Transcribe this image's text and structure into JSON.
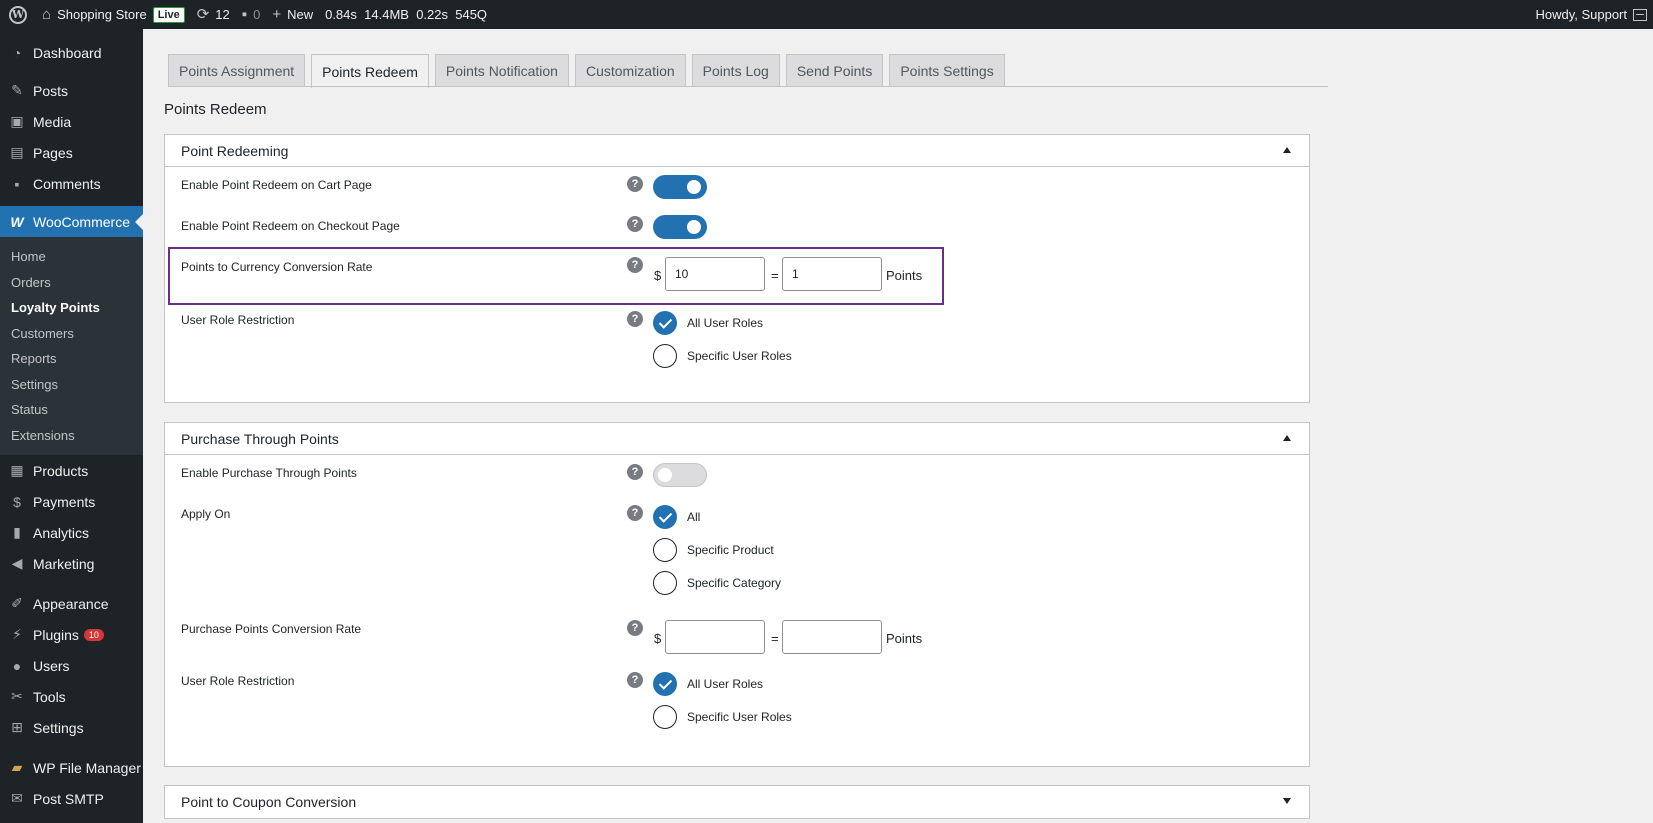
{
  "admin_bar": {
    "site_name": "Shopping Store",
    "live_label": "Live",
    "updates_count": "12",
    "comments_count": "0",
    "new_label": "New",
    "perf": [
      "0.84s",
      "14.4MB",
      "0.22s",
      "545Q"
    ],
    "greeting": "Howdy, Support"
  },
  "sidebar": {
    "top": [
      {
        "label": "Dashboard",
        "icon": "dashboard-icon"
      }
    ],
    "group1": [
      {
        "label": "Posts",
        "icon": "pin-icon"
      },
      {
        "label": "Media",
        "icon": "media-icon"
      },
      {
        "label": "Pages",
        "icon": "pages-icon"
      },
      {
        "label": "Comments",
        "icon": "comment-icon"
      }
    ],
    "woocommerce": {
      "label": "WooCommerce",
      "icon": "woo-icon"
    },
    "woo_sub": [
      "Home",
      "Orders",
      "Loyalty Points",
      "Customers",
      "Reports",
      "Settings",
      "Status",
      "Extensions"
    ],
    "group2": [
      {
        "label": "Products",
        "icon": "products-icon"
      },
      {
        "label": "Payments",
        "icon": "payments-icon"
      },
      {
        "label": "Analytics",
        "icon": "analytics-icon"
      },
      {
        "label": "Marketing",
        "icon": "megaphone-icon"
      }
    ],
    "group3": [
      {
        "label": "Appearance",
        "icon": "brush-icon"
      },
      {
        "label": "Plugins",
        "icon": "plugin-icon",
        "badge": "10"
      },
      {
        "label": "Users",
        "icon": "users-icon"
      },
      {
        "label": "Tools",
        "icon": "wrench-icon"
      },
      {
        "label": "Settings",
        "icon": "settings-icon"
      }
    ],
    "group4": [
      {
        "label": "WP File Manager",
        "icon": "folder-icon"
      },
      {
        "label": "Post SMTP",
        "icon": "mail-icon"
      }
    ]
  },
  "tabs": [
    "Points Assignment",
    "Points Redeem",
    "Points Notification",
    "Customization",
    "Points Log",
    "Send Points",
    "Points Settings"
  ],
  "active_tab": "Points Redeem",
  "page_title": "Points Redeem",
  "panel1": {
    "title": "Point Redeeming",
    "cart_label": "Enable Point Redeem on Cart Page",
    "cart_enabled": true,
    "checkout_label": "Enable Point Redeem on Checkout Page",
    "checkout_enabled": true,
    "rate_label": "Points to Currency Conversion Rate",
    "currency_symbol": "$",
    "currency_value": "10",
    "equals": "=",
    "points_value": "1",
    "points_unit": "Points",
    "role_label": "User Role Restriction",
    "role_options": [
      "All User Roles",
      "Specific User Roles"
    ],
    "role_selected": "All User Roles"
  },
  "panel2": {
    "title": "Purchase Through Points",
    "enable_label": "Enable Purchase Through Points",
    "enable_on": false,
    "apply_label": "Apply On",
    "apply_options": [
      "All",
      "Specific Product",
      "Specific Category"
    ],
    "apply_selected": "All",
    "rate_label": "Purchase Points Conversion Rate",
    "currency_symbol": "$",
    "currency_value": "",
    "equals": "=",
    "points_value": "",
    "points_unit": "Points",
    "role_label": "User Role Restriction",
    "role_options": [
      "All User Roles",
      "Specific User Roles"
    ],
    "role_selected": "All User Roles"
  },
  "panel3": {
    "title": "Point to Coupon Conversion"
  },
  "colors": {
    "accent": "#2271b1",
    "highlight_border": "#6b2d8c",
    "admin_dark": "#1d2327"
  }
}
